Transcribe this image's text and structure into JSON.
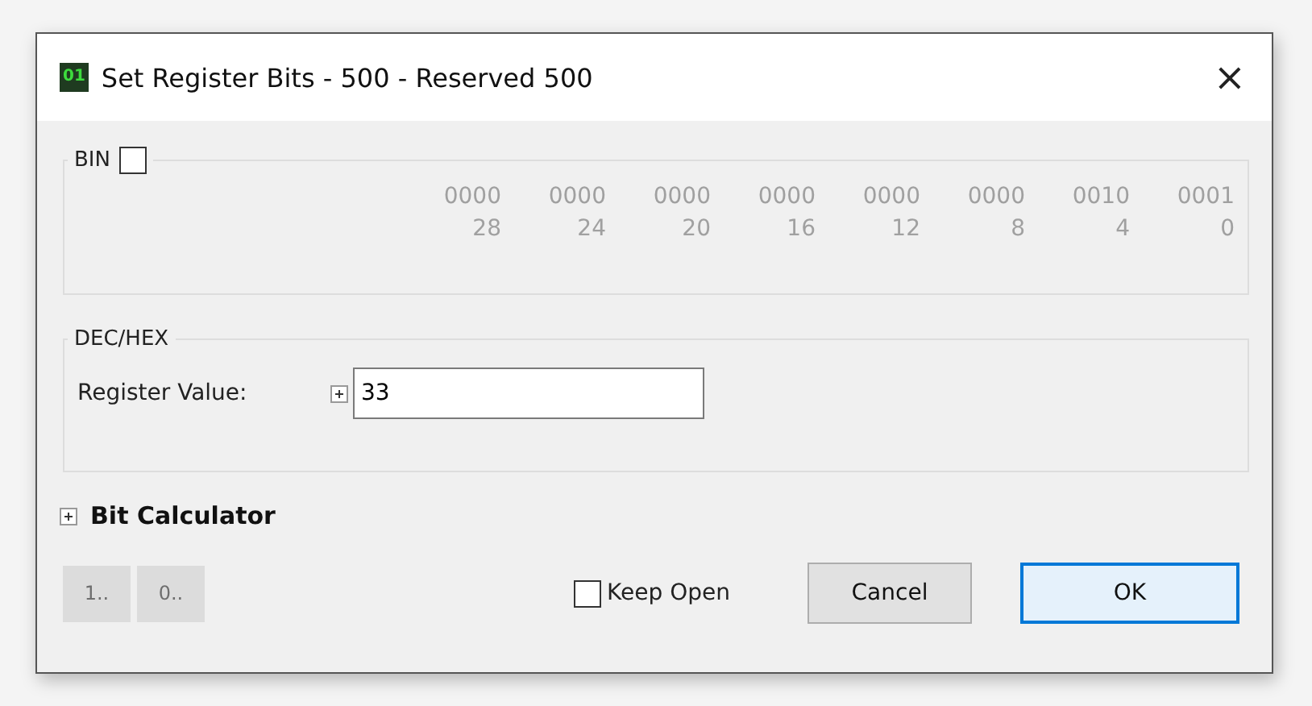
{
  "window": {
    "icon_text": "01",
    "title": "Set Register Bits - 500 - Reserved 500",
    "close": "×"
  },
  "bin": {
    "label": "BIN",
    "checked": false,
    "groups": [
      {
        "bits": "0000",
        "index": "28"
      },
      {
        "bits": "0000",
        "index": "24"
      },
      {
        "bits": "0000",
        "index": "20"
      },
      {
        "bits": "0000",
        "index": "16"
      },
      {
        "bits": "0000",
        "index": "12"
      },
      {
        "bits": "0000",
        "index": "8"
      },
      {
        "bits": "0010",
        "index": "4"
      },
      {
        "bits": "0001",
        "index": "0"
      }
    ]
  },
  "dec_hex": {
    "label": "DEC/HEX",
    "field_label": "Register Value:",
    "value": "33",
    "expanded": false
  },
  "bit_calculator": {
    "label": "Bit Calculator",
    "expanded": false
  },
  "small_buttons": [
    {
      "label": "1..",
      "disabled": true
    },
    {
      "label": "0..",
      "disabled": true
    }
  ],
  "keep_open": {
    "label": "Keep Open",
    "checked": false
  },
  "buttons": [
    {
      "label": "Cancel",
      "default": false
    },
    {
      "label": "OK",
      "default": true
    }
  ]
}
